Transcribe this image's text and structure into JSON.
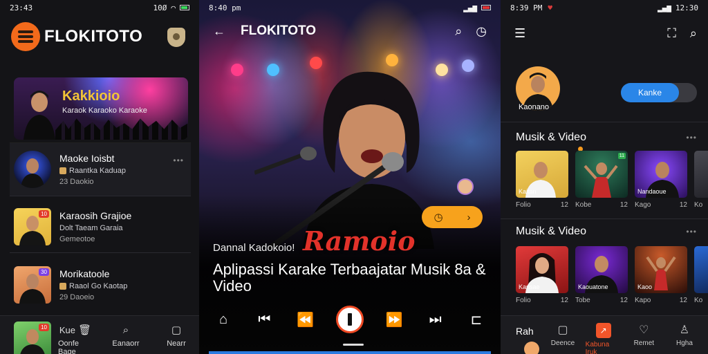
{
  "panel1": {
    "status": {
      "time": "23:43",
      "right": "10Ø"
    },
    "logo": {
      "text": "FLOKITOTO"
    },
    "banner": {
      "title": "Kakkioio",
      "subtitle": "Karaok Karaoko Karaoke"
    },
    "rows": [
      {
        "title": "Maoke Ioisbt",
        "sub": "Raantka Kaduap",
        "meta": "23 Daokio"
      },
      {
        "title": "Karaosih Grajioe",
        "sub": "Dolt Taeam Garaia",
        "meta": "Gemeotoe"
      },
      {
        "title": "Morikatoole",
        "sub": "Raaol Go Kaotap",
        "meta": "29 Daoeio"
      }
    ],
    "bottom_nav": [
      {
        "label": "Oonfe Bage",
        "top": "Kue"
      },
      {
        "label": "Eanaorr",
        "top": ""
      },
      {
        "label": "Nearr",
        "top": ""
      }
    ]
  },
  "panel2": {
    "status": {
      "time": "8:40 pm"
    },
    "header": {
      "title": "FLOKITOTO"
    },
    "subtle": "Dannal Kadokoio!",
    "brand_word": "Ramoio",
    "big_title": "Aplipassi Karake Terbaajatar Musik 8a & Video"
  },
  "panel3": {
    "status": {
      "time": "8:39 PM",
      "right": "12:30"
    },
    "profile_name": "Kaonano",
    "toggle_label": "Kanke",
    "sections": [
      {
        "title": "Musik & Video",
        "cards": [
          {
            "caption": "Kaitan",
            "left": "Folio",
            "right": "12"
          },
          {
            "caption": "",
            "left": "Kobe",
            "right": "12"
          },
          {
            "caption": "Nandaoue",
            "left": "Kago",
            "right": "12"
          },
          {
            "caption": "",
            "left": "Ko",
            "right": ""
          }
        ]
      },
      {
        "title": "Musik & Video",
        "cards": [
          {
            "caption": "Kansae",
            "left": "Folio",
            "right": "12"
          },
          {
            "caption": "Kaouatone",
            "left": "Tobe",
            "right": "12"
          },
          {
            "caption": "Kaoo",
            "left": "Kapo",
            "right": "12"
          },
          {
            "caption": "",
            "left": "Ko",
            "right": ""
          }
        ]
      }
    ],
    "bottom_nav": {
      "left_label": "Rah",
      "items": [
        {
          "label": "Deence"
        },
        {
          "label": "Kabuna Iruk"
        },
        {
          "label": "Remet"
        },
        {
          "label": "Hgha"
        }
      ]
    }
  },
  "colors": {
    "accent": "#f2552a",
    "brand_blue": "#2f8cff",
    "toggle": "#2a86e8",
    "pill": "#f7a21c"
  }
}
